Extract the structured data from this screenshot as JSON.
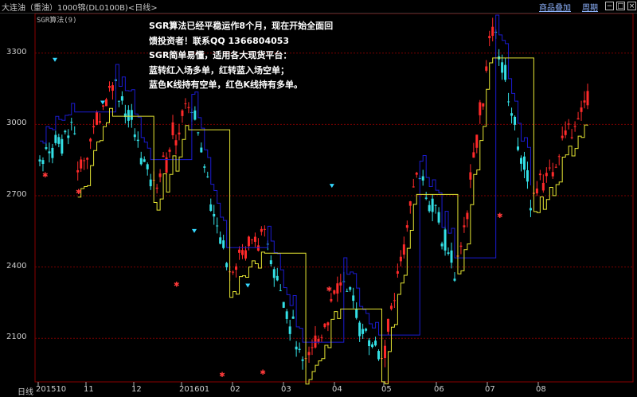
{
  "header": {
    "title": "大连油（重油）1000锦(DL0100B)<日线>",
    "btn_add": "商品叠加",
    "btn_period": "周期"
  },
  "indicator_label": "SGR算法(9)",
  "annotations": [
    "SGR算法已经平稳运作8个月，现在开始全面回",
    "馈投资者！联系QQ 1366804053",
    "SGR简单易懂，适用各大现货平台：",
    "蓝转红入场多单，红转蓝入场空单；",
    "蓝色K线持有空单，红色K线持有多单。"
  ],
  "colors": {
    "up": "#ff2a2a",
    "down": "#33e0e6",
    "stop_short": "#1b1bd0",
    "stop_long": "#e6e633",
    "grid": "#7a0000",
    "short_marker": "#35d8ff",
    "long_marker": "#ff3a3a"
  },
  "chart_data": {
    "type": "candlestick",
    "xlabel": "日线",
    "x_ticks": [
      "201510",
      "11",
      "12",
      "201601",
      "02",
      "03",
      "04",
      "05",
      "06",
      "07",
      "08"
    ],
    "y_ticks": [
      2100,
      2400,
      2700,
      3000,
      3300
    ],
    "ylim": [
      1900,
      3450
    ],
    "series": [
      {
        "type": "regime",
        "color": "down",
        "start": 2870,
        "end": 2980,
        "low": 2800,
        "high": 3050
      },
      {
        "type": "regime",
        "color": "up",
        "start": 2790,
        "end": 3190,
        "low": 2790,
        "high": 3260
      },
      {
        "type": "regime",
        "color": "down",
        "start": 3180,
        "end": 2760,
        "low": 2740,
        "high": 3210
      },
      {
        "type": "regime",
        "color": "up",
        "start": 2740,
        "end": 3090,
        "low": 2730,
        "high": 3110
      },
      {
        "type": "regime",
        "color": "down",
        "start": 3060,
        "end": 2420,
        "low": 2330,
        "high": 3080
      },
      {
        "type": "regime",
        "color": "up",
        "start": 2420,
        "end": 2540,
        "low": 2380,
        "high": 2560
      },
      {
        "type": "regime",
        "color": "down",
        "start": 2520,
        "end": 1990,
        "low": 1960,
        "high": 2540
      },
      {
        "type": "regime",
        "color": "up",
        "start": 1980,
        "end": 2330,
        "low": 1960,
        "high": 2340
      },
      {
        "type": "regime",
        "color": "down",
        "start": 2330,
        "end": 2010,
        "low": 1990,
        "high": 2340
      },
      {
        "type": "regime",
        "color": "up",
        "start": 2000,
        "end": 2780,
        "low": 1980,
        "high": 2800
      },
      {
        "type": "regime",
        "color": "down",
        "start": 2790,
        "end": 2410,
        "low": 2310,
        "high": 2800
      },
      {
        "type": "regime",
        "color": "up",
        "start": 2400,
        "end": 3400,
        "low": 2380,
        "high": 3420
      },
      {
        "type": "regime",
        "color": "down",
        "start": 3380,
        "end": 2680,
        "low": 2620,
        "high": 3390
      },
      {
        "type": "regime",
        "color": "up",
        "start": 2690,
        "end": 3120,
        "low": 2680,
        "high": 3260
      }
    ],
    "signals": [
      {
        "type": "short",
        "month_index": 0.35,
        "value": 3270
      },
      {
        "type": "long",
        "month_index": 0.15,
        "value": 2790
      },
      {
        "type": "short",
        "month_index": 1.35,
        "value": 3090
      },
      {
        "type": "long",
        "month_index": 0.85,
        "value": 2720
      },
      {
        "type": "short",
        "month_index": 3.25,
        "value": 2550
      },
      {
        "type": "long",
        "month_index": 2.9,
        "value": 2330
      },
      {
        "type": "short",
        "month_index": 4.3,
        "value": 2320
      },
      {
        "type": "long",
        "month_index": 3.8,
        "value": 1950
      },
      {
        "type": "long",
        "month_index": 4.6,
        "value": 1960
      },
      {
        "type": "short",
        "month_index": 5.95,
        "value": 2740
      },
      {
        "type": "long",
        "month_index": 5.9,
        "value": 2310
      },
      {
        "type": "long",
        "month_index": 9.25,
        "value": 2620
      }
    ]
  }
}
